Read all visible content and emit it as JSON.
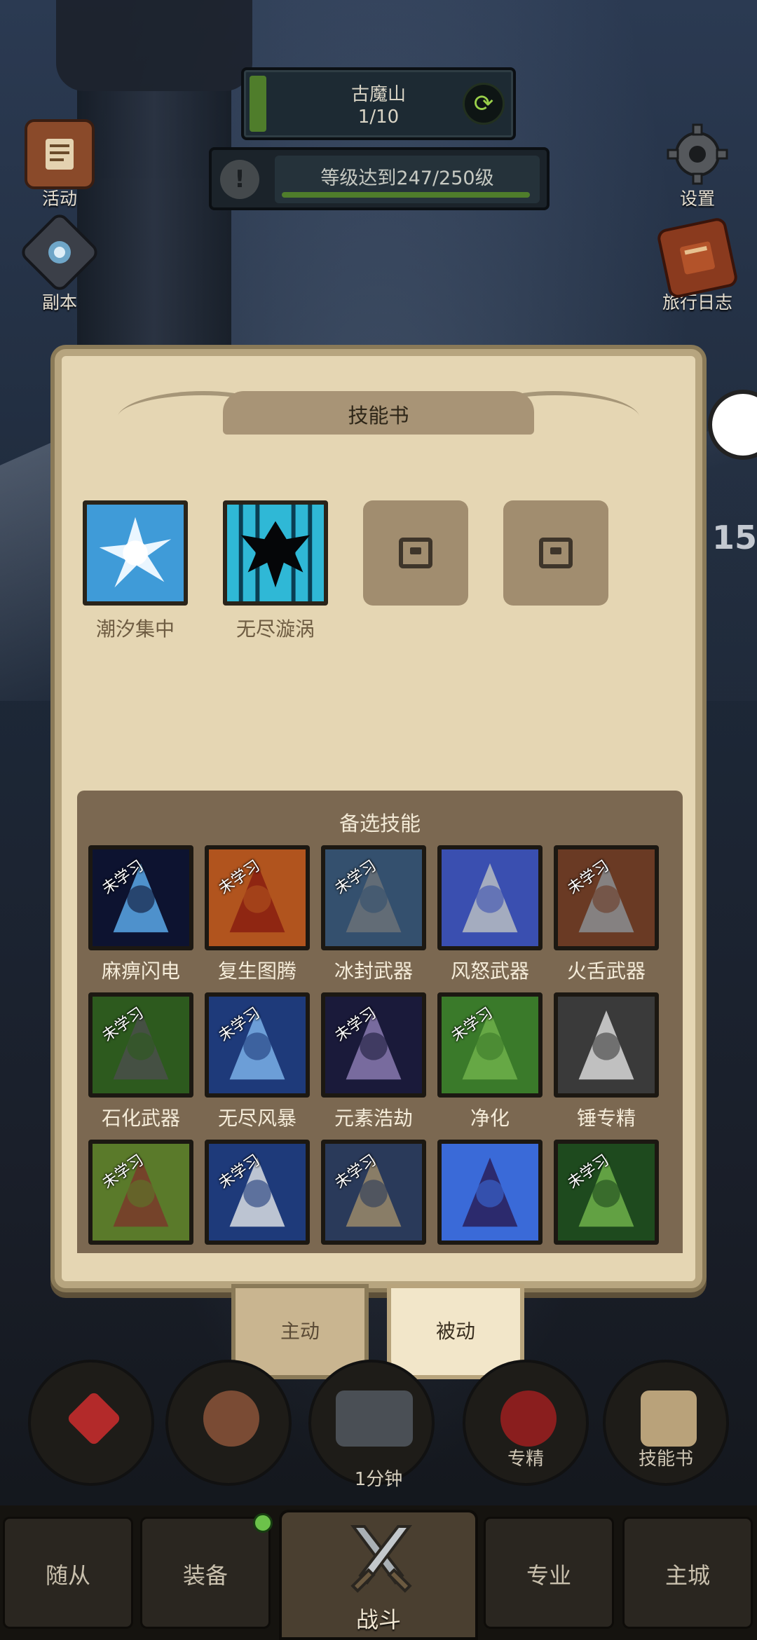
{
  "stage": {
    "name": "古魔山",
    "progress": "1/10"
  },
  "quest": {
    "text": "等级达到247/250级",
    "progress_pct": 98.8
  },
  "left_buttons": [
    {
      "label": "活动",
      "icon": "scroll-icon"
    },
    {
      "label": "副本",
      "icon": "portal-icon"
    }
  ],
  "right_buttons": [
    {
      "label": "设置",
      "icon": "gear-icon"
    },
    {
      "label": "旅行日志",
      "icon": "book-icon"
    }
  ],
  "skill_book": {
    "title": "技能书",
    "learned": [
      {
        "name": "潮汐集中",
        "icon": "tidal-burst-icon"
      },
      {
        "name": "无尽漩涡",
        "icon": "endless-vortex-icon"
      },
      {
        "name": "",
        "icon": "lock-icon"
      },
      {
        "name": "",
        "icon": "lock-icon"
      }
    ],
    "alternate_title": "备选技能",
    "not_learned_tag": "未学习",
    "alternates": [
      {
        "name": "麻痹闪电",
        "tagged": true
      },
      {
        "name": "复生图腾",
        "tagged": true
      },
      {
        "name": "冰封武器",
        "tagged": true
      },
      {
        "name": "风怒武器",
        "tagged": false
      },
      {
        "name": "火舌武器",
        "tagged": true
      },
      {
        "name": "石化武器",
        "tagged": true
      },
      {
        "name": "无尽风暴",
        "tagged": true
      },
      {
        "name": "元素浩劫",
        "tagged": true
      },
      {
        "name": "净化",
        "tagged": true
      },
      {
        "name": "锤专精",
        "tagged": false
      },
      {
        "name": "",
        "tagged": true
      },
      {
        "name": "",
        "tagged": true
      },
      {
        "name": "",
        "tagged": true
      },
      {
        "name": "",
        "tagged": false
      },
      {
        "name": "",
        "tagged": true
      }
    ]
  },
  "tabs": {
    "active": "主动",
    "passive": "被动"
  },
  "actions": {
    "specialize": "专精",
    "skillbook": "技能书",
    "timer": "1分钟"
  },
  "nav": {
    "followers": "随从",
    "equipment": "装备",
    "battle": "战斗",
    "profession": "专业",
    "city": "主城"
  },
  "peek_text": "15",
  "colors": {
    "parchment": "#e5d6b3",
    "panel": "#7b6851",
    "accent_green": "#4f7d2b"
  }
}
